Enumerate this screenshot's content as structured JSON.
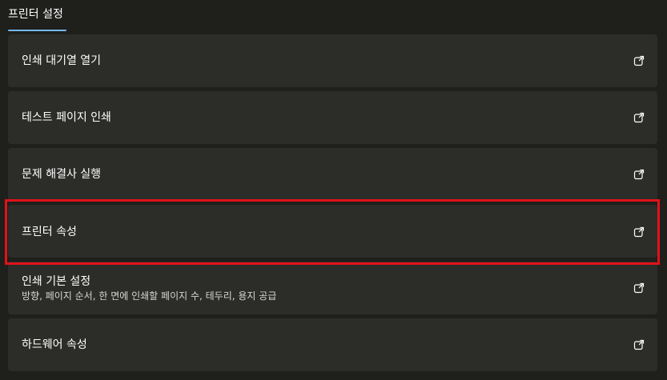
{
  "header": {
    "tab_label": "프린터 설정"
  },
  "items": [
    {
      "title": "인쇄 대기열 열기",
      "subtitle": "",
      "icon": "open-external-icon"
    },
    {
      "title": "테스트 페이지 인쇄",
      "subtitle": "",
      "icon": "open-external-icon"
    },
    {
      "title": "문제 해결사 실행",
      "subtitle": "",
      "icon": "open-external-icon"
    },
    {
      "title": "프린터 속성",
      "subtitle": "",
      "icon": "open-external-icon",
      "highlighted": true
    },
    {
      "title": "인쇄 기본 설정",
      "subtitle": "방향, 페이지 순서, 한 면에 인쇄할 페이지 수, 테두리, 용지 공급",
      "icon": "open-external-icon"
    },
    {
      "title": "하드웨어 속성",
      "subtitle": "",
      "icon": "open-external-icon"
    }
  ],
  "colors": {
    "background": "#1f1f1c",
    "card": "#2c2c29",
    "accent_underline": "#76b9ed",
    "highlight_box": "#e0121b"
  }
}
